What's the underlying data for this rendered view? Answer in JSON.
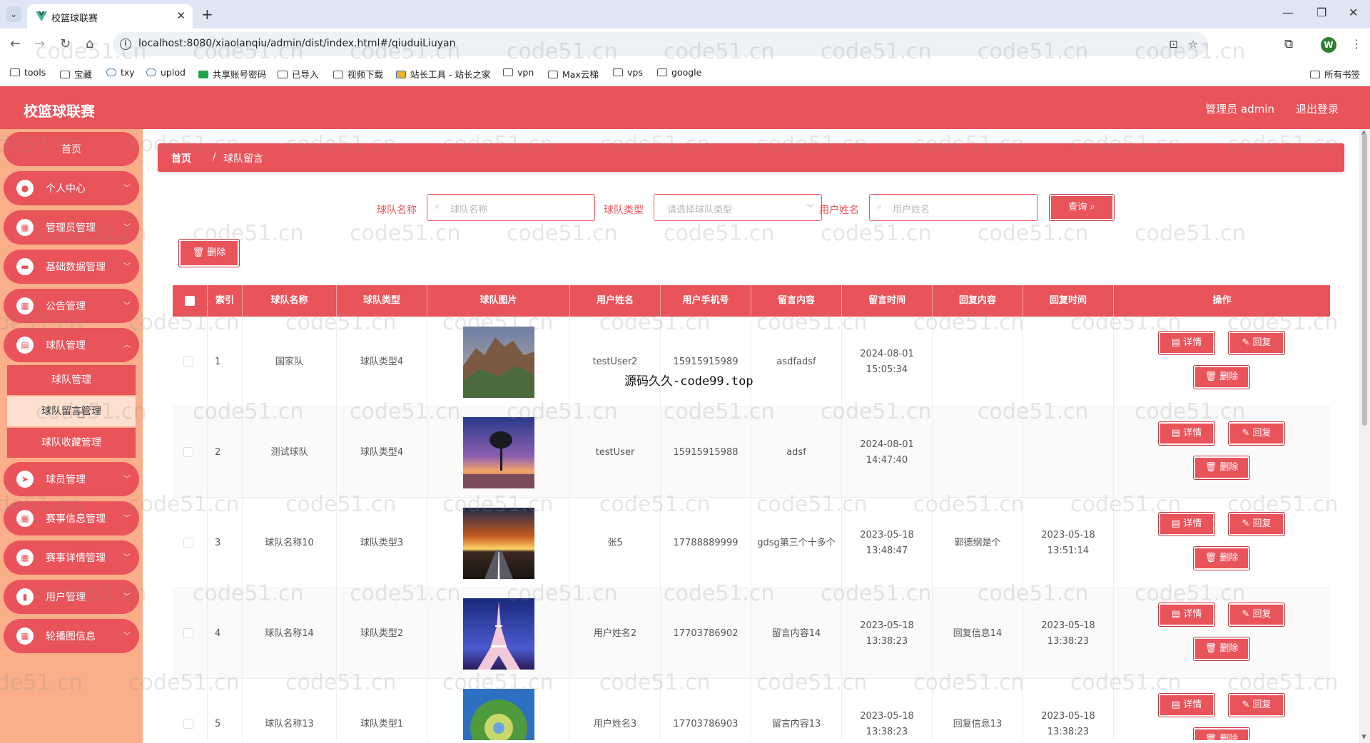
{
  "browser": {
    "tab_title": "校篮球联赛",
    "url": "localhost:8080/xiaolanqiu/admin/dist/index.html#/qiuduiLiuyan",
    "bookmarks": [
      "tools",
      "宝藏",
      "txy",
      "uplod",
      "共享账号密码",
      "已导入",
      "视频下载",
      "站长工具 - 站长之家",
      "vpn",
      "Max云梯",
      "vps",
      "google"
    ],
    "bookmarks_right": "所有书签",
    "profile_initial": "W"
  },
  "header": {
    "title": "校篮球联赛",
    "user": "管理员 admin",
    "logout": "退出登录"
  },
  "sidebar": {
    "home": "首页",
    "items": [
      {
        "label": "个人中心",
        "icon": "user-icon"
      },
      {
        "label": "管理员管理",
        "icon": "grid-icon"
      },
      {
        "label": "基础数据管理",
        "icon": "ticket-icon"
      },
      {
        "label": "公告管理",
        "icon": "grid-icon"
      },
      {
        "label": "球队管理",
        "icon": "doc-icon"
      }
    ],
    "sub_items": [
      "球队管理",
      "球队留言管理",
      "球队收藏管理"
    ],
    "items_after": [
      {
        "label": "球员管理",
        "icon": "send-icon"
      },
      {
        "label": "赛事信息管理",
        "icon": "grid-icon"
      },
      {
        "label": "赛事详情管理",
        "icon": "grid-icon"
      },
      {
        "label": "用户管理",
        "icon": "book-icon"
      },
      {
        "label": "轮播图信息",
        "icon": "grid-icon"
      }
    ]
  },
  "breadcrumb": {
    "home": "首页",
    "sep": "/",
    "current": "球队留言"
  },
  "search": {
    "team_name_label": "球队名称",
    "team_name_placeholder": "球队名称",
    "team_type_label": "球队类型",
    "team_type_placeholder": "请选择球队类型",
    "user_name_label": "用户姓名",
    "user_name_placeholder": "用户姓名",
    "query_button": "查询"
  },
  "toolbar": {
    "delete_button": "删除"
  },
  "table": {
    "columns": [
      "索引",
      "球队名称",
      "球队类型",
      "球队图片",
      "用户姓名",
      "用户手机号",
      "留言内容",
      "留言时间",
      "回复内容",
      "回复时间",
      "操作"
    ],
    "rows": [
      {
        "index": "1",
        "team_name": "国家队",
        "team_type": "球队类型4",
        "image": "mountain-photo",
        "user_name": "testUser2",
        "phone": "15915915989",
        "message": "asdfadsf",
        "message_time": "2024-08-01 15:05:34",
        "reply": "",
        "reply_time": ""
      },
      {
        "index": "2",
        "team_name": "测试球队",
        "team_type": "球队类型4",
        "image": "tree-sunset-photo",
        "user_name": "testUser",
        "phone": "15915915988",
        "message": "adsf",
        "message_time": "2024-08-01 14:47:40",
        "reply": "",
        "reply_time": ""
      },
      {
        "index": "3",
        "team_name": "球队名称10",
        "team_type": "球队类型3",
        "image": "road-sunset-photo",
        "user_name": "张5",
        "phone": "17788889999",
        "message": "gdsg第三个十多个",
        "message_time": "2023-05-18 13:48:47",
        "reply": "郭德纲是个",
        "reply_time": "2023-05-18 13:51:14"
      },
      {
        "index": "4",
        "team_name": "球队名称14",
        "team_type": "球队类型2",
        "image": "eiffel-tower-photo",
        "user_name": "用户姓名2",
        "phone": "17703786902",
        "message": "留言内容14",
        "message_time": "2023-05-18 13:38:23",
        "reply": "回复信息14",
        "reply_time": "2023-05-18 13:38:23"
      },
      {
        "index": "5",
        "team_name": "球队名称13",
        "team_type": "球队类型1",
        "image": "planet-photo",
        "user_name": "用户姓名3",
        "phone": "17703786903",
        "message": "留言内容13",
        "message_time": "2023-05-18 13:38:23",
        "reply": "回复信息13",
        "reply_time": "2023-05-18 13:38:23"
      }
    ],
    "row_actions": {
      "detail": "详情",
      "reply": "回复",
      "delete": "删除"
    }
  },
  "overlay_text": "源码久久-code99.top",
  "watermark": "code51.cn",
  "colors": {
    "primary": "#e9535a",
    "sidebar_bg": "#fbae8a"
  }
}
